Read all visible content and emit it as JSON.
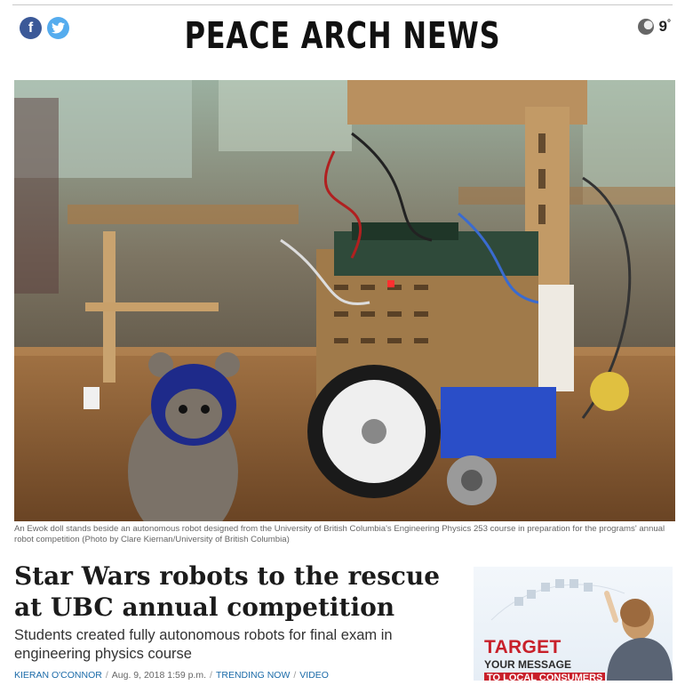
{
  "header": {
    "site_title": "PEACE ARCH NEWS",
    "social": {
      "facebook_glyph": "f",
      "facebook_icon": "facebook-icon",
      "twitter_icon": "twitter-icon"
    },
    "weather": {
      "icon": "moon-icon",
      "temperature": "9",
      "degree": "°"
    }
  },
  "article": {
    "photo_icon": "robot-photo",
    "caption": "An Ewok doll stands beside an autonomous robot designed from the University of British Columbia's Engineering Physics 253 course in preparation for the programs' annual robot competition (Photo by Clare Kiernan/University of British Columbia)",
    "headline": "Star Wars robots to the rescue at UBC annual competition",
    "deck": "Students created fully autonomous robots for final exam in engineering physics course",
    "byline": {
      "author": "KIERAN O'CONNOR",
      "date": "Aug. 9, 2018 1:59 p.m.",
      "categories": [
        "TRENDING NOW",
        "VIDEO"
      ]
    }
  },
  "ad": {
    "line1": "TARGET",
    "line2": "YOUR MESSAGE",
    "line3": "TO LOCAL CONSUMERS"
  },
  "colors": {
    "link": "#1a6aa8",
    "facebook": "#3b5998",
    "twitter": "#55acee",
    "ad_red": "#c8202a"
  }
}
